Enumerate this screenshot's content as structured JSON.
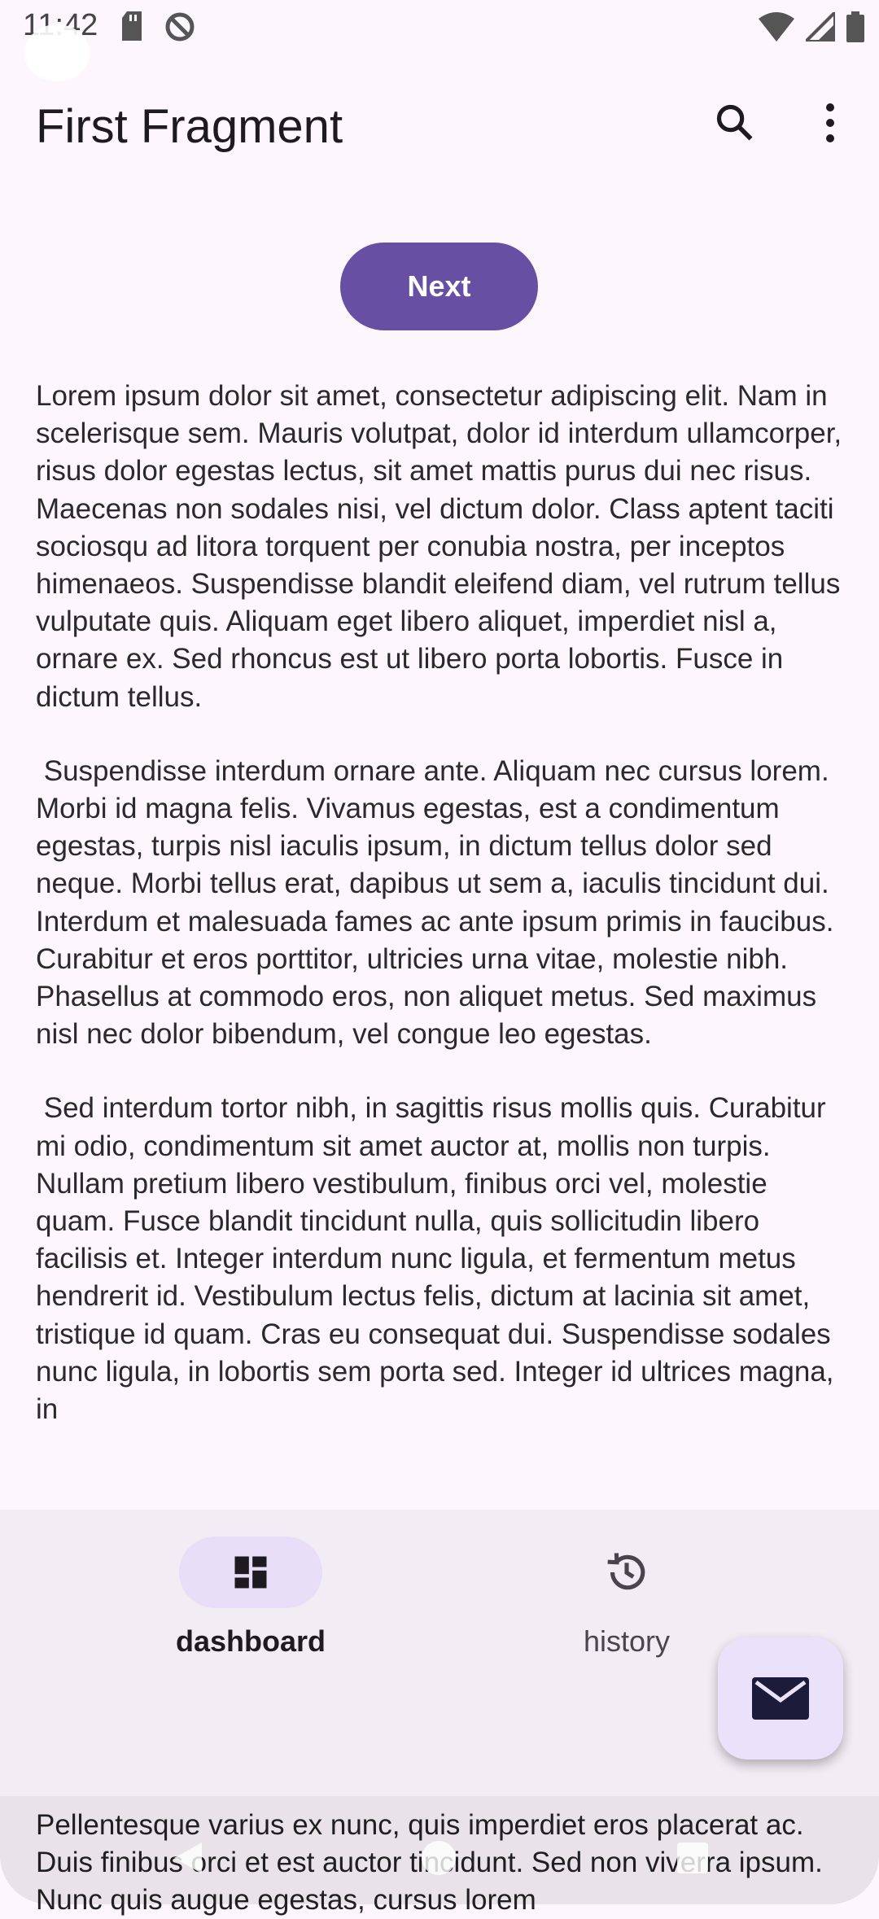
{
  "status_bar": {
    "time": "11:42"
  },
  "app_bar": {
    "title": "First Fragment"
  },
  "next_button": {
    "label": "Next"
  },
  "content": {
    "paragraphs": [
      "Lorem ipsum dolor sit amet, consectetur adipiscing elit. Nam in scelerisque sem. Mauris volutpat, dolor id interdum ullamcorper, risus dolor egestas lectus, sit amet mattis purus dui nec risus. Maecenas non sodales nisi, vel dictum dolor. Class aptent taciti sociosqu ad litora torquent per conubia nostra, per inceptos himenaeos. Suspendisse blandit eleifend diam, vel rutrum tellus vulputate quis. Aliquam eget libero aliquet, imperdiet nisl a, ornare ex. Sed rhoncus est ut libero porta lobortis. Fusce in dictum tellus.",
      " Suspendisse interdum ornare ante. Aliquam nec cursus lorem. Morbi id magna felis. Vivamus egestas, est a condimentum egestas, turpis nisl iaculis ipsum, in dictum tellus dolor sed neque. Morbi tellus erat, dapibus ut sem a, iaculis tincidunt dui. Interdum et malesuada fames ac ante ipsum primis in faucibus. Curabitur et eros porttitor, ultricies urna vitae, molestie nibh. Phasellus at commodo eros, non aliquet metus. Sed maximus nisl nec dolor bibendum, vel congue leo egestas.",
      " Sed interdum tortor nibh, in sagittis risus mollis quis. Curabitur mi odio, condimentum sit amet auctor at, mollis non turpis. Nullam pretium libero vestibulum, finibus orci vel, molestie quam. Fusce blandit tincidunt nulla, quis sollicitudin libero facilisis et. Integer interdum nunc ligula, et fermentum metus hendrerit id. Vestibulum lectus felis, dictum at lacinia sit amet, tristique id quam. Cras eu consequat dui. Suspendisse sodales nunc ligula, in lobortis sem porta sed. Integer id ultrices magna, in"
    ],
    "overflow": "Pellentesque varius ex nunc, quis imperdiet eros placerat ac. Duis finibus orci et est auctor tincidunt. Sed non viverra ipsum. Nunc quis augue egestas, cursus lorem"
  },
  "bottom_nav": {
    "items": [
      {
        "label": "dashboard",
        "icon": "dashboard-icon",
        "active": true
      },
      {
        "label": "history",
        "icon": "history-icon",
        "active": false
      }
    ]
  },
  "fab": {
    "icon": "mail-icon"
  },
  "colors": {
    "primary": "#6750a4",
    "nav_bg": "#f2ecf4",
    "pill": "#e8def8",
    "fab": "#eae2fb"
  }
}
